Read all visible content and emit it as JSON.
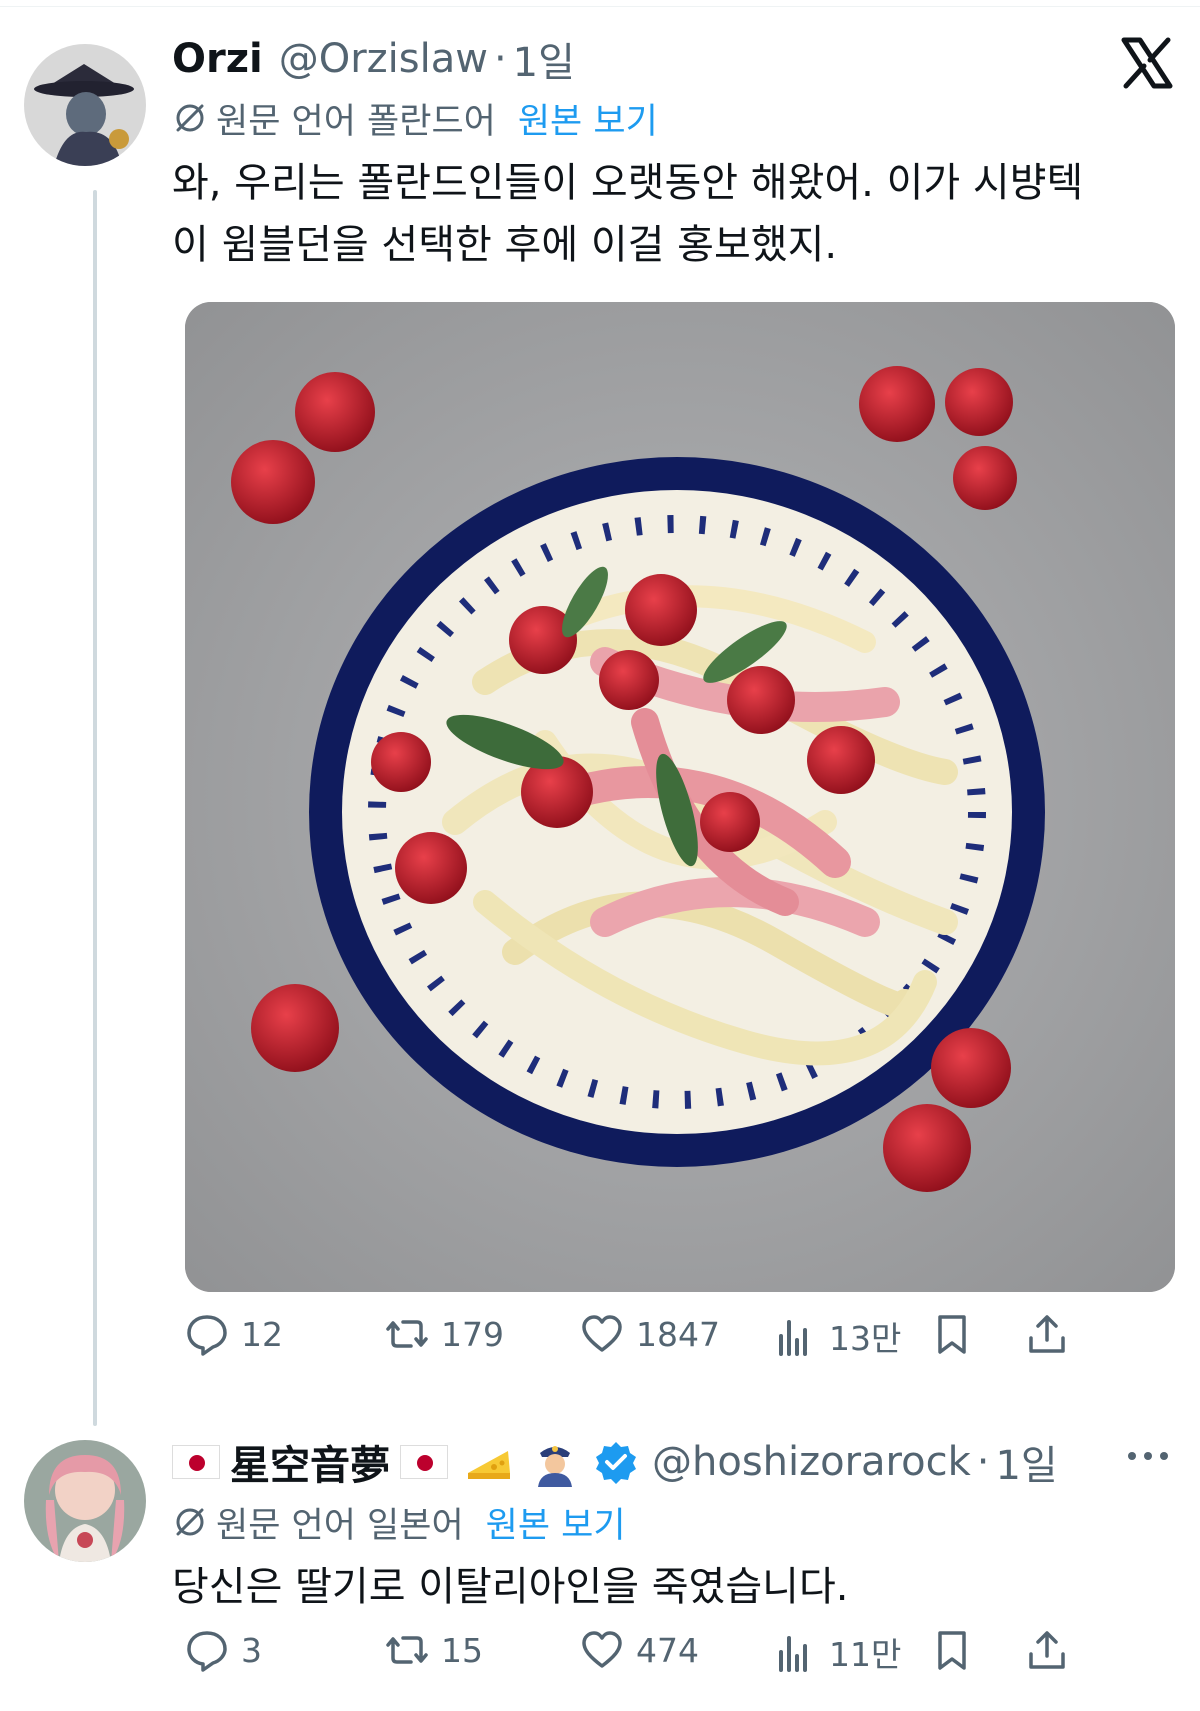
{
  "post": {
    "display_name": "Orzi",
    "handle": "@Orzislaw",
    "separator": "·",
    "time": "1일",
    "translation_note": "원문 언어 폴란드어",
    "show_original": "원본 보기",
    "text_line1": "와, 우리는 폴란드인들이 오랫동안 해왔어. 이가 시뱡텍",
    "text_line2": "이 윔블던을 선택한 후에 이걸 홍보했지.",
    "metrics": {
      "replies": "12",
      "reposts": "179",
      "likes": "1847",
      "views": "13만"
    }
  },
  "reply": {
    "display_name": "星空音夢",
    "handle": "@hoshizorarock",
    "separator": "·",
    "time": "1일",
    "translation_note": "원문 언어 일본어",
    "show_original": "원본 보기",
    "text": "당신은 딸기로 이탈리아인을 죽였습니다.",
    "metrics": {
      "replies": "3",
      "reposts": "15",
      "likes": "474",
      "views": "11만"
    }
  },
  "icons": {
    "logo": "x-logo-icon",
    "more": "more-icon",
    "reply": "reply-icon",
    "repost": "repost-icon",
    "like": "heart-icon",
    "views": "views-icon",
    "bookmark": "bookmark-icon",
    "share": "share-icon",
    "translate": "translate-icon",
    "verified": "verified-badge-icon"
  },
  "colors": {
    "text": "#0f1419",
    "secondary": "#536471",
    "link": "#1d9bf0",
    "verified": "#1d9bf0",
    "thread_line": "#cfd9de"
  }
}
